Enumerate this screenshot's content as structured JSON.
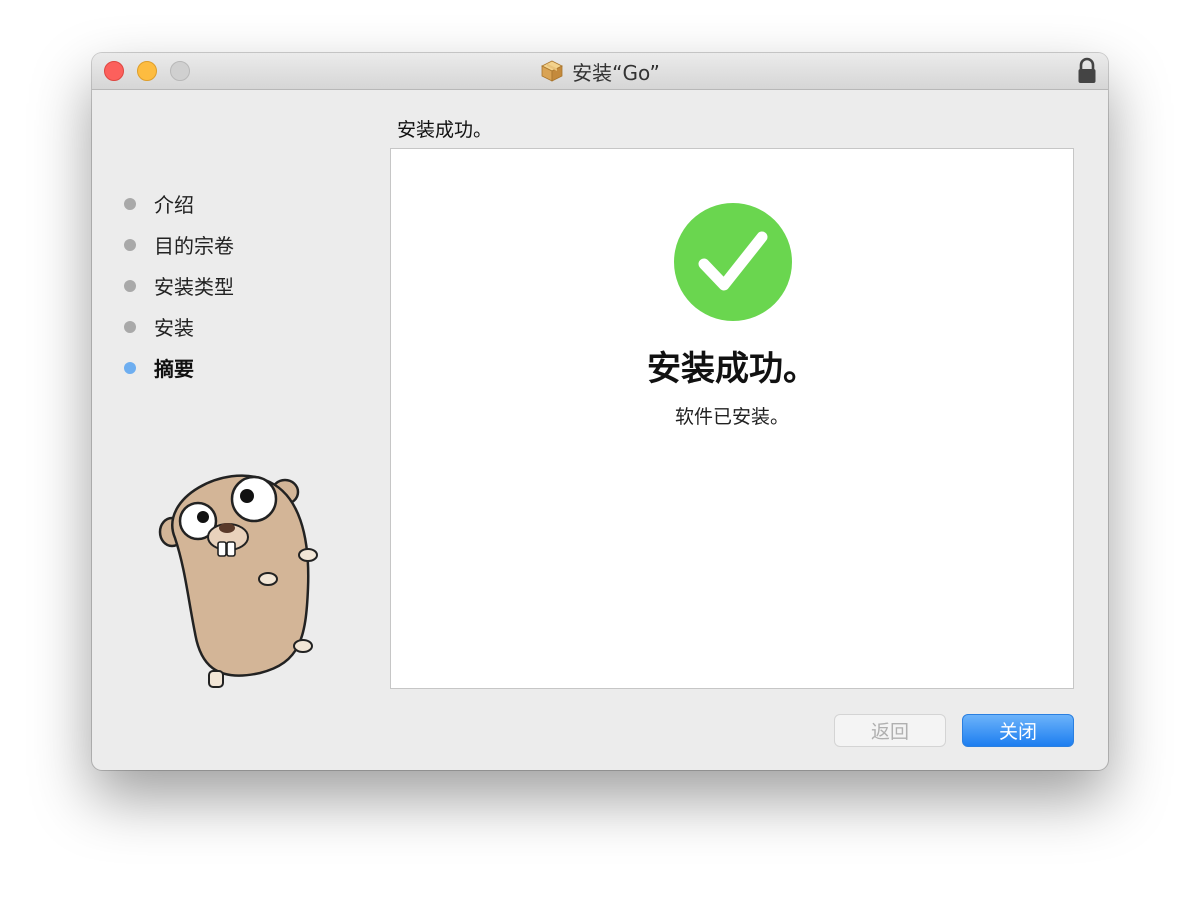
{
  "window": {
    "title": "安装“Go”",
    "icon": "package-icon",
    "lock_icon": "lock-icon"
  },
  "header": {
    "subtitle": "安装成功。"
  },
  "sidebar": {
    "steps": [
      {
        "label": "介绍",
        "active": false
      },
      {
        "label": "目的宗卷",
        "active": false
      },
      {
        "label": "安装类型",
        "active": false
      },
      {
        "label": "安装",
        "active": false
      },
      {
        "label": "摘要",
        "active": true
      }
    ],
    "mascot": "gopher-mascot"
  },
  "content": {
    "icon": "checkmark-icon",
    "title": "安装成功。",
    "message": "软件已安装。"
  },
  "buttons": {
    "back_label": "返回",
    "close_label": "关闭"
  },
  "colors": {
    "success_green": "#6ad64f",
    "accent_blue": "#1d7ef0",
    "active_step_dot": "#6eaef0",
    "inactive_step_dot": "#a9a9a9"
  }
}
